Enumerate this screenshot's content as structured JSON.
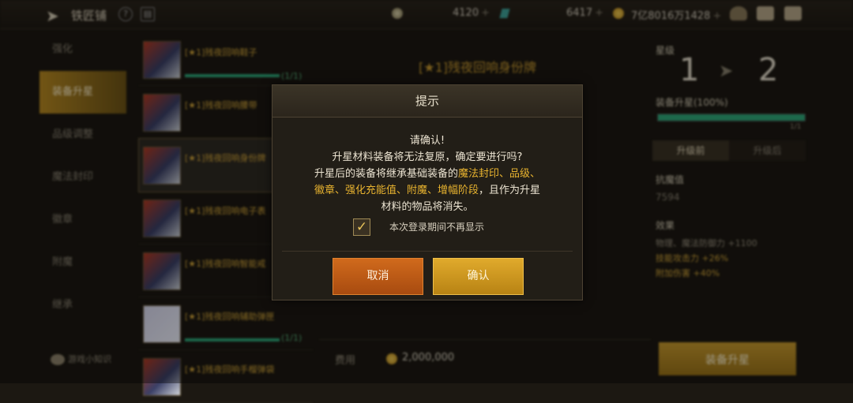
{
  "header": {
    "title": "铁匠铺",
    "resources": [
      {
        "value": "4120"
      },
      {
        "value": "6417"
      },
      {
        "value": "7亿8016万1428"
      }
    ]
  },
  "sidebar": {
    "items": [
      {
        "label": "强化",
        "active": false
      },
      {
        "label": "装备升星",
        "active": true
      },
      {
        "label": "品级调整",
        "active": false
      },
      {
        "label": "魔法封印",
        "active": false
      },
      {
        "label": "徽章",
        "active": false
      },
      {
        "label": "附魔",
        "active": false
      },
      {
        "label": "继承",
        "active": false
      }
    ],
    "tips_label": "游戏小知识"
  },
  "equipment_list": [
    {
      "name": "[★1]残夜回响鞋子",
      "count": "(1/1)"
    },
    {
      "name": "[★1]残夜回响腰带",
      "count": ""
    },
    {
      "name": "[★1]残夜回响身份牌",
      "count": ""
    },
    {
      "name": "[★1]残夜回响电子表",
      "count": ""
    },
    {
      "name": "[★1]残夜回响智能戒",
      "count": ""
    },
    {
      "name": "[★1]残夜回响辅助弹匣",
      "count": "(1/1)"
    },
    {
      "name": "[★1]残夜回响手榴弹袋",
      "count": ""
    }
  ],
  "center": {
    "item_title": "[★1]残夜回响身份牌",
    "cost_label": "费用",
    "cost_value": "2,000,000"
  },
  "right_panel": {
    "star_label": "星级",
    "star_from": "1",
    "star_to": "2",
    "upgrade_label": "装备升星(100%)",
    "upgrade_count": "1/1",
    "tabs": [
      {
        "label": "升级前",
        "active": true
      },
      {
        "label": "升级后",
        "active": false
      }
    ],
    "stat_title": "抗魔值",
    "stat_value": "7594",
    "effects_title": "效果",
    "effects": [
      "物理、魔法防御力 +1100",
      "技能攻击力 +26%",
      "附加伤害 +40%"
    ],
    "upgrade_button": "装备升星"
  },
  "dialog": {
    "title": "提示",
    "line1": "请确认!",
    "line2": "升星材料装备将无法复原，确定要进行吗?",
    "line3_prefix": "升星后的装备将继承基础装备的",
    "line3_highlight": "魔法封印、品级、",
    "line4_highlight": "徽章、强化充能值、附魔、增幅阶段",
    "line4_suffix": "，且作为升星",
    "line5": "材料的物品将消失。",
    "checkbox_label": "本次登录期间不再显示",
    "checkbox_checked": true,
    "cancel_label": "取消",
    "confirm_label": "确认"
  }
}
